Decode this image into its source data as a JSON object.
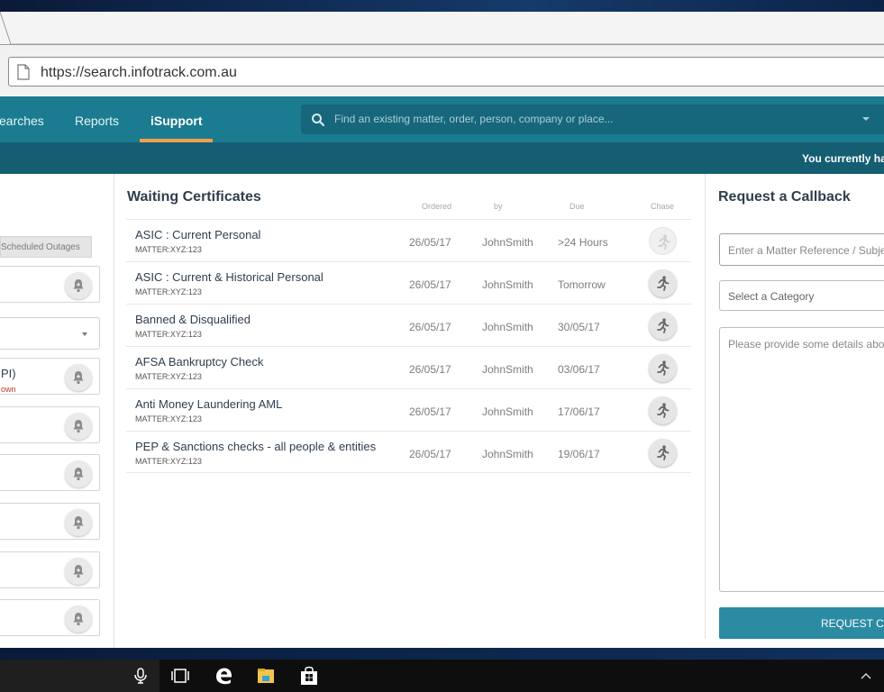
{
  "browser": {
    "url": "https://search.infotrack.com.au"
  },
  "nav": {
    "items": [
      {
        "label": "earches"
      },
      {
        "label": "Reports"
      },
      {
        "label": "iSupport"
      }
    ],
    "search_placeholder": "Find an existing matter, order, person, company or place...",
    "notice": "You currently hav"
  },
  "left_panel": {
    "tab_label": "Scheduled Outages",
    "partial_title": "PI)",
    "partial_sub": "own"
  },
  "waiting": {
    "title": "Waiting Certificates",
    "headers": {
      "ordered": "Ordered",
      "by": "by",
      "due": "Due",
      "chase": "Chase"
    },
    "rows": [
      {
        "name": "ASIC : Current Personal",
        "matter": "MATTER:XYZ:123",
        "ordered": "26/05/17",
        "by": "JohnSmith",
        "due": ">24 Hours"
      },
      {
        "name": "ASIC : Current & Historical Personal",
        "matter": "MATTER:XYZ:123",
        "ordered": "26/05/17",
        "by": "JohnSmith",
        "due": "Tomorrow"
      },
      {
        "name": "Banned & Disqualified",
        "matter": "MATTER:XYZ:123",
        "ordered": "26/05/17",
        "by": "JohnSmith",
        "due": "30/05/17"
      },
      {
        "name": "AFSA Bankruptcy Check",
        "matter": "MATTER:XYZ:123",
        "ordered": "26/05/17",
        "by": "JohnSmith",
        "due": "03/06/17"
      },
      {
        "name": "Anti Money Laundering AML",
        "matter": "MATTER:XYZ:123",
        "ordered": "26/05/17",
        "by": "JohnSmith",
        "due": "17/06/17"
      },
      {
        "name": "PEP & Sanctions checks - all people & entities",
        "matter": "MATTER:XYZ:123",
        "ordered": "26/05/17",
        "by": "JohnSmith",
        "due": "19/06/17"
      }
    ]
  },
  "callback": {
    "title": "Request a Callback",
    "matter_placeholder": "Enter a Matter Reference / Subjec",
    "category_placeholder": "Select a Category",
    "details_placeholder": "Please provide some details abou",
    "button_label": "REQUEST CA"
  },
  "colors": {
    "nav_bg": "#1b7b91",
    "notice_bg": "#155e71",
    "accent_underline": "#f0a050",
    "button_bg": "#2b8ba3"
  }
}
